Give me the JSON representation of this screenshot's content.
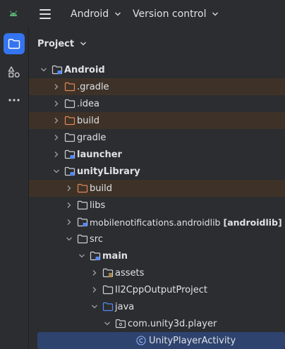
{
  "topbar": {
    "project_menu": "Android",
    "vcs_menu": "Version control"
  },
  "panel": {
    "title": "Project"
  },
  "colors": {
    "accent": "#3574f0",
    "excluded_bg": "#3e3228",
    "selected_bg": "#2e436e",
    "folder": "#ced0d6",
    "excluded_folder": "#e08855",
    "source_folder": "#548af7",
    "module_badge": "#548af7",
    "android_green": "#5fb878"
  },
  "tree": [
    {
      "label": "Android",
      "arrow": "down",
      "icon": "module-folder-icon",
      "bold": true,
      "excluded": false
    },
    {
      "label": ".gradle",
      "arrow": "right",
      "icon": "excluded-folder-icon",
      "bold": false,
      "excluded": true
    },
    {
      "label": ".idea",
      "arrow": "right",
      "icon": "folder-icon",
      "bold": false,
      "excluded": false
    },
    {
      "label": "build",
      "arrow": "right",
      "icon": "excluded-folder-icon",
      "bold": false,
      "excluded": true
    },
    {
      "label": "gradle",
      "arrow": "right",
      "icon": "folder-icon",
      "bold": false,
      "excluded": false
    },
    {
      "label": "launcher",
      "arrow": "right",
      "icon": "module-folder-icon",
      "bold": true,
      "excluded": false
    },
    {
      "label": "unityLibrary",
      "arrow": "down",
      "icon": "module-folder-icon",
      "bold": true,
      "excluded": false
    },
    {
      "label": "build",
      "arrow": "right",
      "icon": "excluded-folder-icon",
      "bold": false,
      "excluded": true
    },
    {
      "label": "libs",
      "arrow": "right",
      "icon": "folder-icon",
      "bold": false,
      "excluded": false
    },
    {
      "label": "mobilenotifications.androidlib",
      "suffix": "[androidlib]",
      "arrow": "right",
      "icon": "module-folder-icon",
      "bold": false,
      "excluded": false
    },
    {
      "label": "src",
      "arrow": "down",
      "icon": "folder-icon",
      "bold": false,
      "excluded": false
    },
    {
      "label": "main",
      "arrow": "down",
      "icon": "module-folder-icon",
      "bold": true,
      "excluded": false
    },
    {
      "label": "assets",
      "arrow": "right",
      "icon": "resources-folder-icon",
      "bold": false,
      "excluded": false
    },
    {
      "label": "Il2CppOutputProject",
      "arrow": "right",
      "icon": "folder-icon",
      "bold": false,
      "excluded": false
    },
    {
      "label": "java",
      "arrow": "down",
      "icon": "source-folder-icon",
      "bold": false,
      "excluded": false
    },
    {
      "label": "com.unity3d.player",
      "arrow": "down",
      "icon": "package-icon",
      "bold": false,
      "excluded": false
    },
    {
      "label": "UnityPlayerActivity",
      "arrow": "none",
      "icon": "class-icon",
      "bold": false,
      "excluded": false,
      "selected": true
    }
  ]
}
